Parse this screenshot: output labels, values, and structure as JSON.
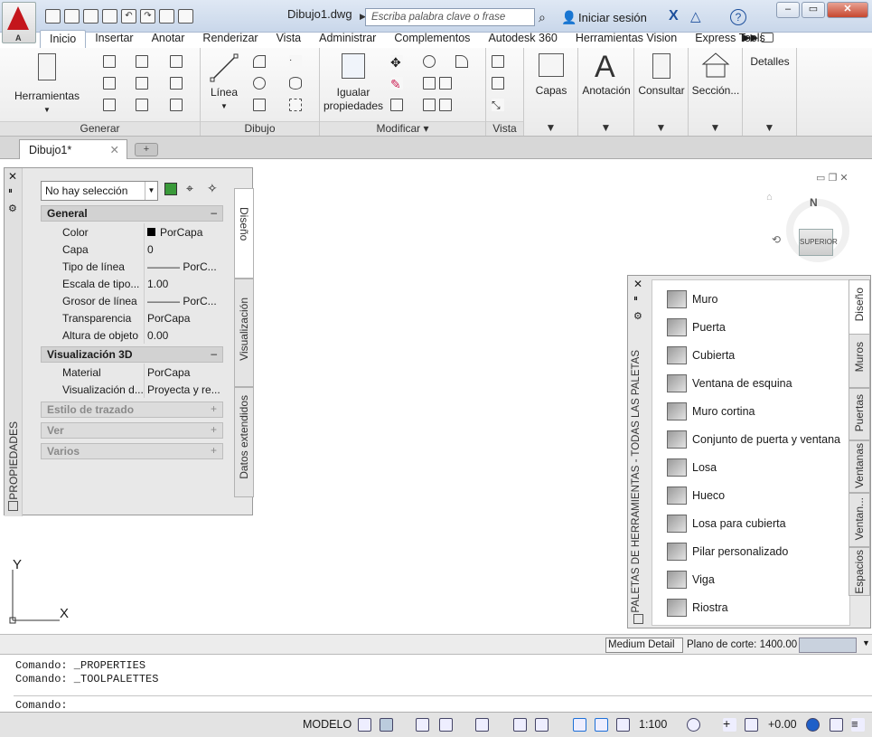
{
  "window": {
    "title": "Dibujo1.dwg",
    "app_letter": "A"
  },
  "search": {
    "placeholder": "Escriba palabra clave o frase"
  },
  "user": {
    "login_label": "Iniciar sesión"
  },
  "ribbon_tabs": [
    "Inicio",
    "Insertar",
    "Anotar",
    "Renderizar",
    "Vista",
    "Administrar",
    "Complementos",
    "Autodesk 360",
    "Herramientas Vision",
    "Express Tools"
  ],
  "ribbon_active_tab": "Inicio",
  "ribbon": {
    "generar": {
      "title": "Generar",
      "herramientas": "Herramientas"
    },
    "dibujo": {
      "title": "Dibujo",
      "linea": "Línea"
    },
    "modificar": {
      "title": "Modificar",
      "igualar_1": "Igualar",
      "igualar_2": "propiedades"
    },
    "vista": {
      "title": "Vista"
    },
    "capas": "Capas",
    "anotacion": "Anotación",
    "consultar": "Consultar",
    "seccion": "Sección...",
    "detalles": "Detalles"
  },
  "file_tab": {
    "label": "Dibujo1*"
  },
  "properties": {
    "side_title": "PROPIEDADES",
    "selection": "No hay selección",
    "tabs": [
      "Diseño",
      "Visualización",
      "Datos extendidos"
    ],
    "general": {
      "title": "General",
      "rows": [
        {
          "key": "Color",
          "value": "PorCapa"
        },
        {
          "key": "Capa",
          "value": "0"
        },
        {
          "key": "Tipo de línea",
          "value": "——— PorC..."
        },
        {
          "key": "Escala de tipo...",
          "value": "1.00"
        },
        {
          "key": "Grosor de línea",
          "value": "——— PorC..."
        },
        {
          "key": "Transparencia",
          "value": "PorCapa"
        },
        {
          "key": "Altura de objeto",
          "value": "0.00"
        }
      ]
    },
    "vis3d": {
      "title": "Visualización 3D",
      "rows": [
        {
          "key": "Material",
          "value": "PorCapa"
        },
        {
          "key": "Visualización d...",
          "value": "Proyecta y re..."
        }
      ]
    },
    "collapsed": [
      "Estilo de trazado",
      "Ver",
      "Varios"
    ]
  },
  "toolpalette": {
    "side_title": "PALETAS DE HERRAMIENTAS - TODAS LAS PALETAS",
    "tabs": [
      "Diseño",
      "Muros",
      "Puertas",
      "Ventanas",
      "Ventan...",
      "Espacios"
    ],
    "items": [
      "Muro",
      "Puerta",
      "Cubierta",
      "Ventana de esquina",
      "Muro cortina",
      "Conjunto de puerta y ventana",
      "Losa",
      "Hueco",
      "Losa para cubierta",
      "Pilar personalizado",
      "Viga",
      "Riostra"
    ]
  },
  "viewcube": {
    "top_label": "SUPERIOR",
    "north": "N"
  },
  "ucs": {
    "x": "X",
    "y": "Y"
  },
  "viewbar": {
    "detail": "Medium Detail",
    "cut_plane_label": "Plano de corte:",
    "cut_plane_value": "1400.00"
  },
  "command": {
    "history": [
      "Comando:  _PROPERTIES",
      "Comando:  _TOOLPALETTES"
    ],
    "prompt": "Comando:"
  },
  "status": {
    "model": "MODELO",
    "scale": "1:100",
    "elevation": "+0.00"
  }
}
